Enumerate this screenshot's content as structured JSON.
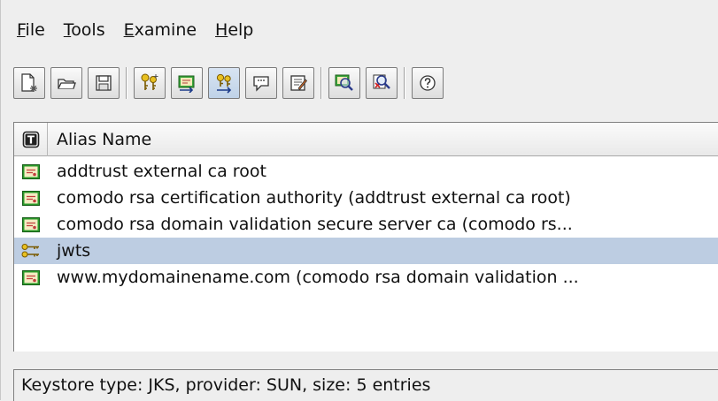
{
  "menu": {
    "items": [
      {
        "mnemonic": "F",
        "rest": "ile"
      },
      {
        "mnemonic": "T",
        "rest": "ools"
      },
      {
        "mnemonic": "E",
        "rest": "xamine"
      },
      {
        "mnemonic": "H",
        "rest": "elp"
      }
    ]
  },
  "toolbar": {
    "buttons": [
      {
        "name": "new-keystore-button",
        "icon": "new-document-icon"
      },
      {
        "name": "open-keystore-button",
        "icon": "open-folder-icon"
      },
      {
        "name": "save-keystore-button",
        "icon": "save-disk-icon"
      },
      {
        "name": "generate-key-pair-button",
        "icon": "key-pair-icon"
      },
      {
        "name": "import-certificate-button",
        "icon": "import-certificate-icon"
      },
      {
        "name": "import-key-pair-button",
        "icon": "import-key-pair-icon"
      },
      {
        "name": "set-password-button",
        "icon": "speech-bubble-icon"
      },
      {
        "name": "keystore-properties-button",
        "icon": "properties-icon"
      },
      {
        "name": "examine-certificate-button",
        "icon": "examine-certificate-icon"
      },
      {
        "name": "examine-crl-button",
        "icon": "examine-crl-icon"
      },
      {
        "name": "help-button",
        "icon": "help-icon"
      }
    ]
  },
  "table": {
    "columns": {
      "type": "T",
      "alias": "Alias Name"
    },
    "rows": [
      {
        "type": "trusted-certificate",
        "icon": "certificate-icon",
        "alias": "addtrust external ca root"
      },
      {
        "type": "trusted-certificate",
        "icon": "certificate-icon",
        "alias": "comodo rsa certification authority (addtrust external ca root)"
      },
      {
        "type": "trusted-certificate",
        "icon": "certificate-icon",
        "alias": "comodo rsa domain validation secure server ca (comodo rs..."
      },
      {
        "type": "key-pair",
        "icon": "key-pair-icon",
        "alias": "jwts"
      },
      {
        "type": "trusted-certificate",
        "icon": "certificate-icon",
        "alias": "www.mydomainename.com (comodo rsa domain validation ..."
      }
    ],
    "selected_alias": "jwts"
  },
  "status": {
    "text": "Keystore type: JKS, provider: SUN, size: 5 entries"
  },
  "colors": {
    "selection": "#bdcde2",
    "background": "#eeeeee",
    "cert_green": "#2a9a2a",
    "key_gold": "#c89a10"
  }
}
